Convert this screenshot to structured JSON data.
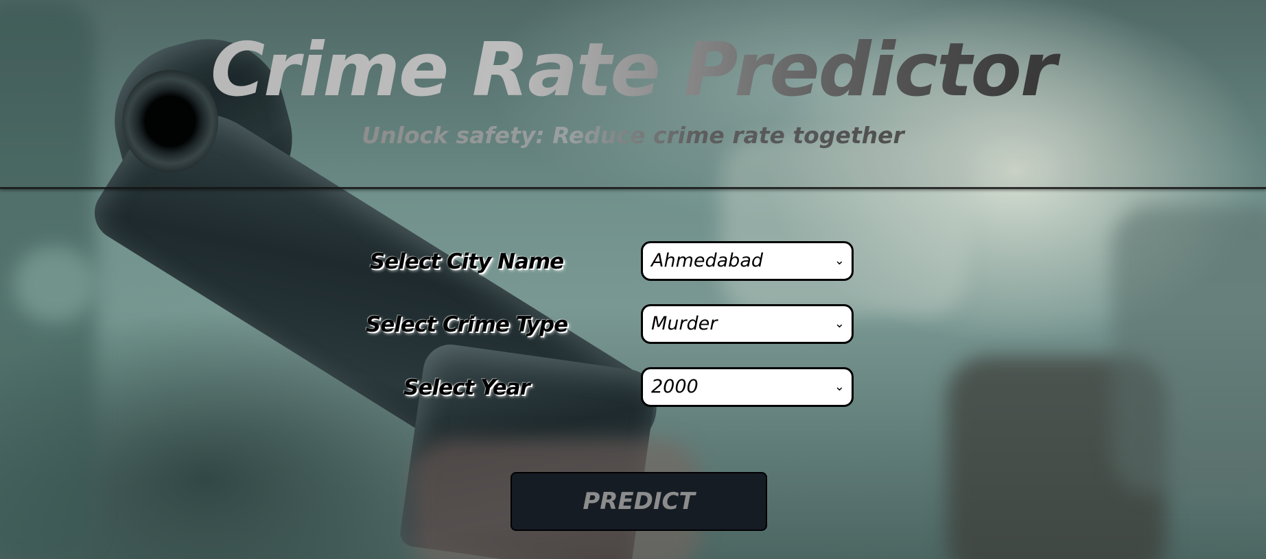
{
  "header": {
    "title": "Crime Rate Predictor",
    "subtitle": "Unlock safety: Reduce crime rate together"
  },
  "form": {
    "city": {
      "label": "Select City Name",
      "selected": "Ahmedabad"
    },
    "crime_type": {
      "label": "Select Crime Type",
      "selected": "Murder"
    },
    "year": {
      "label": "Select Year",
      "selected": "2000"
    },
    "predict_label": "PREDICT"
  },
  "icons": {
    "select_arrow": "chevron-down-icon"
  },
  "colors": {
    "button_bg": "#151c24",
    "button_text": "#8c8c8c",
    "select_bg": "#ffffff",
    "label_text": "#000000"
  }
}
